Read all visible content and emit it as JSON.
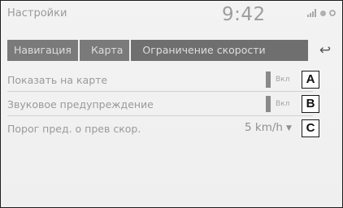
{
  "header": {
    "title": "Настройки",
    "time": "9:42"
  },
  "breadcrumb": [
    "Навигация",
    "Карта",
    "Ограничение скорости"
  ],
  "rows": [
    {
      "label": "Показать на карте",
      "control": "toggle",
      "state": "Вкл",
      "callout": "A"
    },
    {
      "label": "Звуковое предупреждение",
      "control": "toggle",
      "state": "Вкл",
      "callout": "B"
    },
    {
      "label": "Порог пред. о прев скор.",
      "control": "select",
      "value": "5 km/h",
      "callout": "C"
    }
  ]
}
